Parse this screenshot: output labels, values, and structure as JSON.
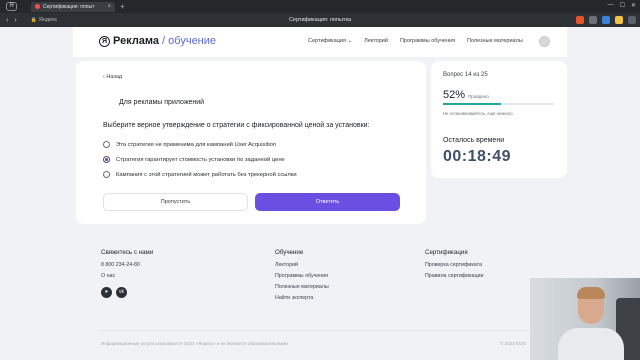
{
  "browser": {
    "tab_title": "Сертификация: попыт",
    "tab_close": "×",
    "new_tab": "+",
    "address_host": "Яндекс",
    "page_title": "Сертификация: попытка"
  },
  "header": {
    "logo_main": "Реклама",
    "logo_sub": "/ обучение",
    "nav": [
      "Сертификация ⌄",
      "Лекторий",
      "Программы обучения",
      "Полезные материалы"
    ]
  },
  "question": {
    "back": "‹  Назад",
    "title": "Для рекламы приложений",
    "prompt": "Выберите верное утверждение о стратегии с фиксированной ценой за установки:",
    "options": [
      {
        "label": "Эта стратегия не применима для кампаний User Acquisition",
        "selected": false
      },
      {
        "label": "Стратегия гарантирует стоимость установки по заданной цене",
        "selected": true
      },
      {
        "label": "Кампания с этой стратегией может работать без трекерной ссылки",
        "selected": false
      }
    ],
    "skip_label": "Пропустить",
    "answer_label": "Ответить"
  },
  "progress": {
    "question_counter": "Вопрос 14 из 25",
    "percent_text": "52%",
    "percent_value": 0.52,
    "percent_label": "Пройдено",
    "hint": "Не останавливайтесь, ещё немного",
    "time_label": "Осталось времени",
    "timer": "00:18:49"
  },
  "footer": {
    "contact_heading": "Свяжитесь с нами",
    "phone": "8 800 234-24-80",
    "about": "О нас",
    "learning_heading": "Обучение",
    "learning_links": [
      "Лекторий",
      "Программы обучения",
      "Полезные материалы",
      "Найти эксперта"
    ],
    "cert_heading": "Сертификация",
    "cert_links": [
      "Проверка сертификата",
      "Правила сертификации"
    ],
    "disclaimer": "Информационные услуги оказываются ООО «Яндекс» и не являются образовательными",
    "copyright": "© 2023 ООО"
  },
  "colors": {
    "accent": "#6a4fe3",
    "progress": "#1fa6a3",
    "timer": "#3f4f6a"
  }
}
